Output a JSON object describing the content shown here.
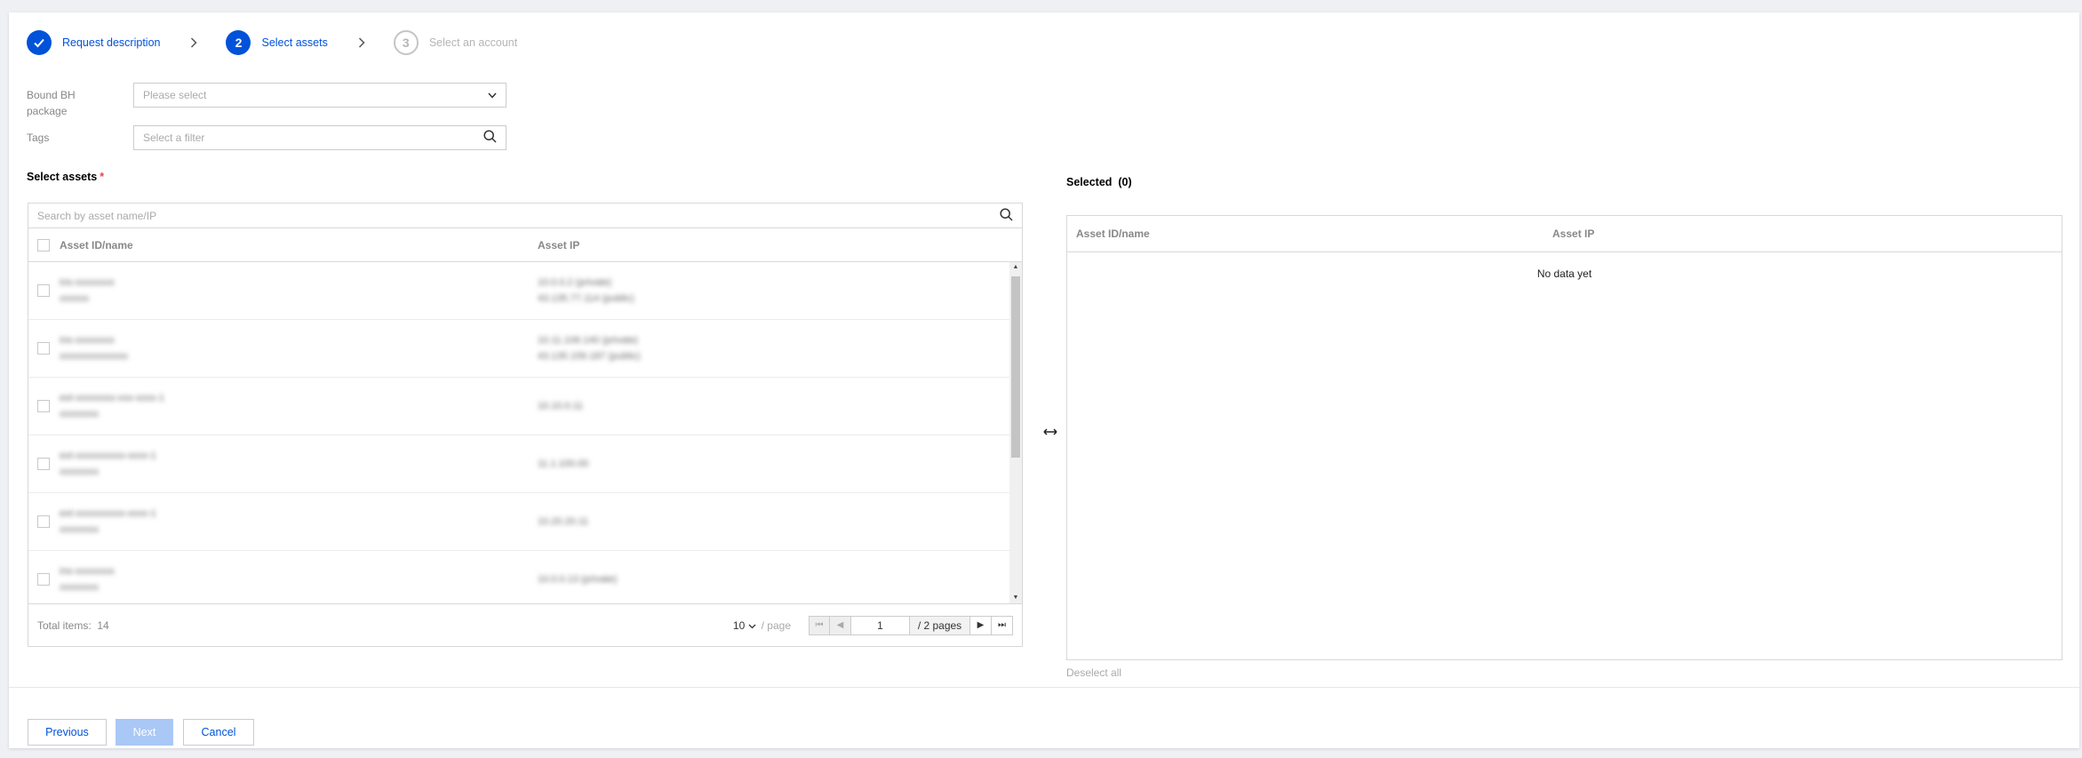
{
  "steps": [
    {
      "index": "✓",
      "label": "Request description",
      "state": "done"
    },
    {
      "index": "2",
      "label": "Select assets",
      "state": "active"
    },
    {
      "index": "3",
      "label": "Select an account",
      "state": "pending"
    }
  ],
  "form": {
    "package_label_line1": "Bound BH",
    "package_label_line2": "package",
    "package_placeholder": "Please select",
    "tags_label": "Tags",
    "tags_placeholder": "Select a filter"
  },
  "left": {
    "title": "Select assets",
    "required_mark": "*",
    "search_placeholder": "Search by asset name/IP",
    "col_name": "Asset ID/name",
    "col_ip": "Asset IP",
    "rows": [
      {
        "id": "ins-xxxxxxxx",
        "name": "xxxxxx",
        "ip1": "10.0.0.2 (private)",
        "ip2": "43.135.77.114 (public)"
      },
      {
        "id": "ins-xxxxxxxx",
        "name": "xxxxxxxxxxxxxx",
        "ip1": "10.11.106.140 (private)",
        "ip2": "43.135.159.187 (public)"
      },
      {
        "id": "ext-xxxxxxxx-xxx-xxxx-1",
        "name": "xxxxxxxx",
        "ip1": "10.10.0.11",
        "ip2": ""
      },
      {
        "id": "ext-xxxxxxxxxx-xxxx-1",
        "name": "xxxxxxxx",
        "ip1": "11.1.100.00",
        "ip2": ""
      },
      {
        "id": "ext-xxxxxxxxxx-xxxx-1",
        "name": "xxxxxxxx",
        "ip1": "10.20.20.11",
        "ip2": ""
      },
      {
        "id": "ins-xxxxxxxx",
        "name": "xxxxxxxx",
        "ip1": "10.0.0.13 (private)",
        "ip2": ""
      }
    ],
    "total_label": "Total items:",
    "total_value": "14",
    "page_size": "10",
    "page_unit": "/ page",
    "current_page": "1",
    "total_pages": "/ 2 pages"
  },
  "right": {
    "title": "Selected",
    "count": "(0)",
    "col_name": "Asset ID/name",
    "col_ip": "Asset IP",
    "empty_text": "No data yet",
    "deselect_all": "Deselect all"
  },
  "footer": {
    "previous": "Previous",
    "next": "Next",
    "cancel": "Cancel"
  },
  "colors": {
    "accent": "#0052d9",
    "required": "#e54545",
    "next_disabled": "#a9c8f5"
  }
}
